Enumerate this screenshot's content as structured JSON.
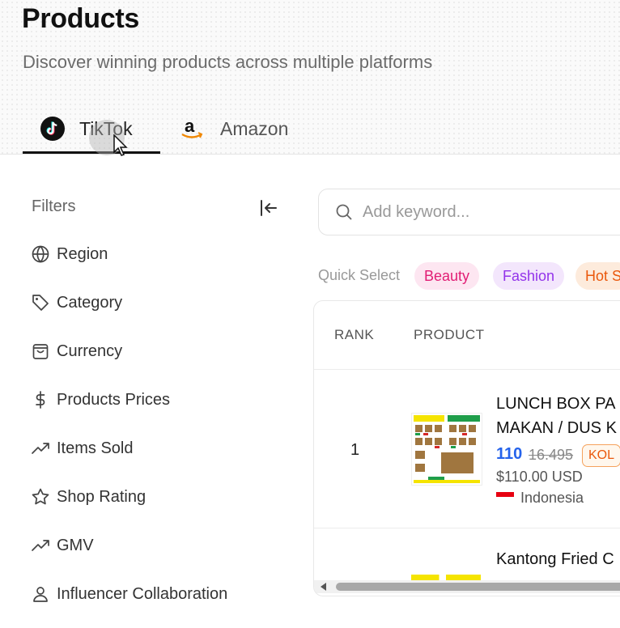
{
  "page": {
    "title": "Products",
    "subtitle": "Discover winning products across multiple platforms"
  },
  "tabs": [
    {
      "label": "TikTok",
      "icon": "tiktok-icon",
      "active": true
    },
    {
      "label": "Amazon",
      "icon": "amazon-icon",
      "active": false
    }
  ],
  "filters": {
    "title": "Filters",
    "items": [
      {
        "label": "Region",
        "icon": "globe-icon"
      },
      {
        "label": "Category",
        "icon": "tag-icon"
      },
      {
        "label": "Currency",
        "icon": "shopping-bag-icon"
      },
      {
        "label": "Products Prices",
        "icon": "dollar-icon"
      },
      {
        "label": "Items Sold",
        "icon": "trending-up-icon"
      },
      {
        "label": "Shop Rating",
        "icon": "star-icon"
      },
      {
        "label": "GMV",
        "icon": "trending-up-icon"
      },
      {
        "label": "Influencer Collaboration",
        "icon": "user-icon"
      }
    ]
  },
  "search": {
    "placeholder": "Add keyword...",
    "value": ""
  },
  "quick_select": {
    "label": "Quick Select",
    "chips": [
      {
        "label": "Beauty",
        "color": "#e11d74"
      },
      {
        "label": "Fashion",
        "color": "#9333ea"
      },
      {
        "label": "Hot S",
        "color": "#ea580c"
      }
    ]
  },
  "table": {
    "columns": [
      "RANK",
      "PRODUCT"
    ],
    "rows": [
      {
        "rank": "1",
        "name_line1": "LUNCH BOX PA",
        "name_line2": "MAKAN / DUS K",
        "price": "110",
        "old_price": "16.495",
        "badge": "KOL",
        "usd": "$110.00 USD",
        "country": "Indonesia"
      },
      {
        "name_line1": "Kantong Fried C"
      }
    ]
  },
  "colors": {
    "accent_blue": "#2563eb",
    "kol_orange": "#ea580c"
  }
}
